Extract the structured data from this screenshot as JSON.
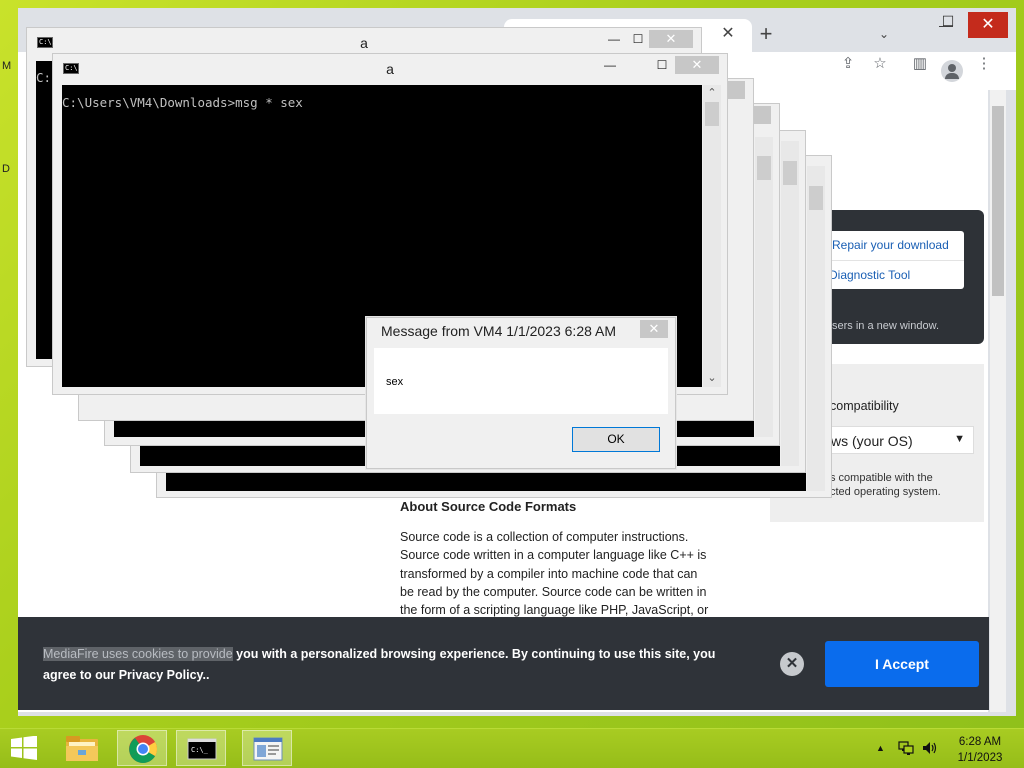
{
  "desktop": {
    "fragment_1": "M",
    "fragment_2": "D"
  },
  "chrome": {
    "tab_close": "✕",
    "new_tab": "+",
    "tab_search": "⌄",
    "win_min": "—",
    "win_max": "☐",
    "win_close": "✕",
    "toolbar_icons": [
      "share-icon",
      "star-icon",
      "side-panel-icon",
      "profile-icon",
      "menu-icon"
    ]
  },
  "page": {
    "menu_links": [
      "Repair your download",
      "Diagnostic Tool"
    ],
    "dark_panel_text": "sers in a new window.",
    "compat_label": "compatibility",
    "os_select_value": "ws (your OS)",
    "compat_note": [
      "s compatible with the",
      "cted operating system."
    ],
    "about_heading": "About Source Code Formats",
    "about_lines": [
      "Source code is a collection of computer instructions.",
      "Source code written in a computer language like C++ is",
      "transformed by a compiler into machine code that can",
      "be read by the computer. Source code can be written in",
      "the form of a scripting language like PHP, JavaScript, or"
    ]
  },
  "cookie": {
    "text_highlight": "MediaFire uses cookies to provide",
    "text_rest": " you with a personalized browsing experience. By continuing to use this site, you agree to our Privacy Policy..",
    "close_glyph": "✕",
    "accept_label": "I Accept"
  },
  "cmd": {
    "window_title": "a",
    "icon_text": "C:\\.",
    "prompt_line": "C:\\Users\\VM4\\Downloads>msg * sex",
    "back_prompt": "C:",
    "min": "—",
    "max": "☐",
    "close": "✕",
    "scroll_up": "⌃",
    "scroll_down": "⌄"
  },
  "message_box": {
    "title": "Message from VM4 1/1/2023 6:28 AM",
    "close": "✕",
    "body": "sex",
    "ok_label": "OK"
  },
  "taskbar": {
    "time": "6:28 AM",
    "date": "1/1/2023",
    "tray_up": "▲",
    "apps": [
      "start-button",
      "file-explorer",
      "chrome",
      "command-prompt",
      "msg-window"
    ]
  },
  "colors": {
    "desktop": "#a9cf1c",
    "accept_button": "#0a6ced",
    "cookie_banner": "#2f3339",
    "close_red": "#c42b1c"
  }
}
